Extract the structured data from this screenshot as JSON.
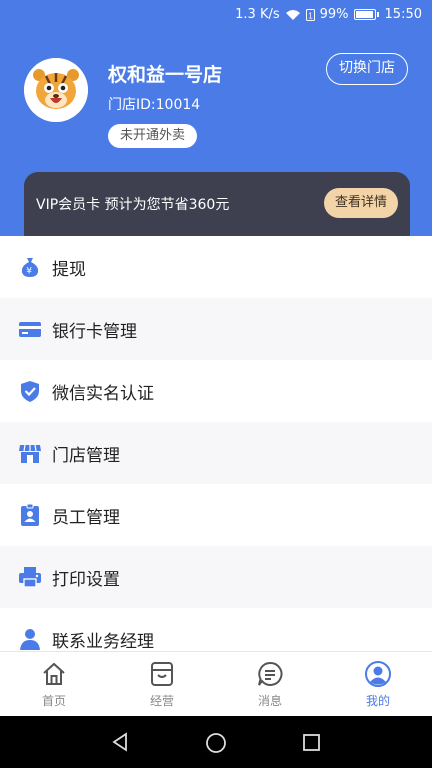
{
  "status_bar": {
    "speed": "1.3 K/s",
    "battery_percent": "99%",
    "time": "15:50"
  },
  "store": {
    "name": "权和益一号店",
    "id_text": "门店ID:10014",
    "delivery_status": "未开通外卖",
    "switch_label": "切换门店"
  },
  "vip": {
    "text": "VIP会员卡 预计为您节省360元",
    "detail_label": "查看详情"
  },
  "menu": {
    "items": [
      {
        "label": "提现",
        "icon": "money-bag-icon"
      },
      {
        "label": "银行卡管理",
        "icon": "bank-card-icon"
      },
      {
        "label": "微信实名认证",
        "icon": "shield-check-icon"
      },
      {
        "label": "门店管理",
        "icon": "store-icon"
      },
      {
        "label": "员工管理",
        "icon": "badge-icon"
      },
      {
        "label": "打印设置",
        "icon": "printer-icon"
      },
      {
        "label": "联系业务经理",
        "icon": "person-icon"
      }
    ]
  },
  "tabs": [
    {
      "label": "首页",
      "icon": "home-icon"
    },
    {
      "label": "经营",
      "icon": "business-icon"
    },
    {
      "label": "消息",
      "icon": "message-icon"
    },
    {
      "label": "我的",
      "icon": "profile-icon",
      "active": true
    }
  ],
  "colors": {
    "primary": "#4a7be6",
    "vip_bg": "#3e404f",
    "vip_button": "#f3d3a8"
  }
}
